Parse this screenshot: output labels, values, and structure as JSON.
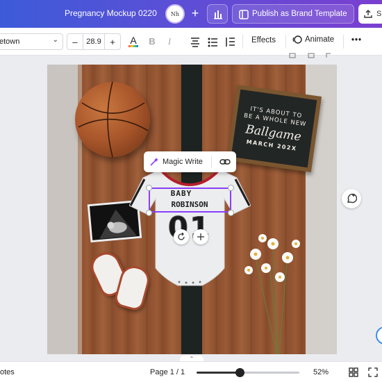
{
  "header": {
    "doc_title": "Pregnancy Mockup 0220",
    "avatar_text": "Nh",
    "publish_label": "Publish as Brand Template",
    "share_label": "S"
  },
  "toolbar": {
    "font_name": "etown",
    "font_size": "28.9",
    "effects_label": "Effects",
    "animate_label": "Animate",
    "more_label": "•••"
  },
  "design": {
    "letterboard_line1": "IT'S ABOUT TO",
    "letterboard_line2": "BE A WHOLE NEW",
    "letterboard_script": "Ballgame",
    "letterboard_line3": "MARCH 202X",
    "jersey_line1": "BABY",
    "jersey_line2": "ROBINSON",
    "jersey_number": "01"
  },
  "popover": {
    "magic_write_label": "Magic Write"
  },
  "footer": {
    "notes_label": "otes",
    "page_indicator": "Page 1 / 1",
    "zoom_label": "52%",
    "zoom_value": 0.52
  },
  "colors": {
    "selection": "#8b3dff",
    "topbar_start": "#3d5bd9",
    "topbar_end": "#7a3fd0"
  }
}
